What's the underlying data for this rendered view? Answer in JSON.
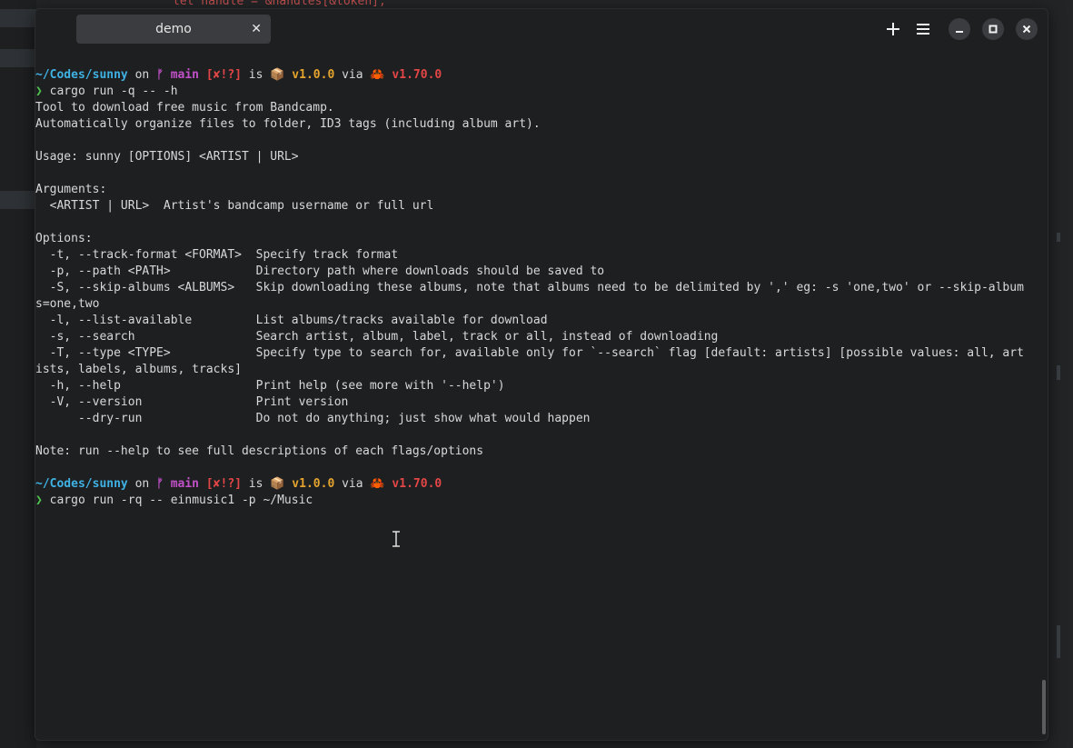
{
  "background_editor": {
    "code_top": "let handle = &handles[&token];"
  },
  "tab": {
    "title": "demo",
    "close_glyph": "✕"
  },
  "titlebar": {
    "new_tab_icon": "plus-icon",
    "menu_icon": "hamburger-menu-icon",
    "minimize_icon": "minimize-icon",
    "maximize_icon": "maximize-icon",
    "close_icon": "close-icon"
  },
  "prompt1": {
    "cwd": "~/Codes/sunny",
    "on": " on ",
    "branch_icon": "ᚠ",
    "branch": " main",
    "status": " [✘!?]",
    "is": " is ",
    "pkg_icon": "📦",
    "pkg_version": " v1.0.0",
    "via": " via ",
    "rust_icon": "🦀",
    "rust_version": " v1.70.0",
    "arrow": "❯",
    "command": " cargo run -q -- -h"
  },
  "output": [
    "Tool to download free music from Bandcamp.",
    "Automatically organize files to folder, ID3 tags (including album art).",
    "",
    "Usage: sunny [OPTIONS] <ARTIST | URL>",
    "",
    "Arguments:",
    "  <ARTIST | URL>  Artist's bandcamp username or full url",
    "",
    "Options:",
    "  -t, --track-format <FORMAT>  Specify track format",
    "  -p, --path <PATH>            Directory path where downloads should be saved to",
    "  -S, --skip-albums <ALBUMS>   Skip downloading these albums, note that albums need to be delimited by ',' eg: -s 'one,two' or --skip-album",
    "s=one,two",
    "  -l, --list-available         List albums/tracks available for download",
    "  -s, --search                 Search artist, album, label, track or all, instead of downloading",
    "  -T, --type <TYPE>            Specify type to search for, available only for `--search` flag [default: artists] [possible values: all, art",
    "ists, labels, albums, tracks]",
    "  -h, --help                   Print help (see more with '--help')",
    "  -V, --version                Print version",
    "      --dry-run                Do not do anything; just show what would happen",
    "",
    "Note: run --help to see full descriptions of each flags/options",
    ""
  ],
  "prompt2": {
    "cwd": "~/Codes/sunny",
    "on": " on ",
    "branch_icon": "ᚠ",
    "branch": " main",
    "status": " [✘!?]",
    "is": " is ",
    "pkg_icon": "📦",
    "pkg_version": " v1.0.0",
    "via": " via ",
    "rust_icon": "🦀",
    "rust_version": " v1.70.0",
    "arrow": "❯",
    "command": " cargo run -rq -- einmusic1 -p ~/Music"
  },
  "colors": {
    "cwd": "#3fb2e4",
    "branch": "#c251c9",
    "status": "#e34646",
    "package": "#e5a42d",
    "prompt_arrow": "#4fc44f",
    "text": "#d8d8d8",
    "background": "#1e1f21"
  }
}
